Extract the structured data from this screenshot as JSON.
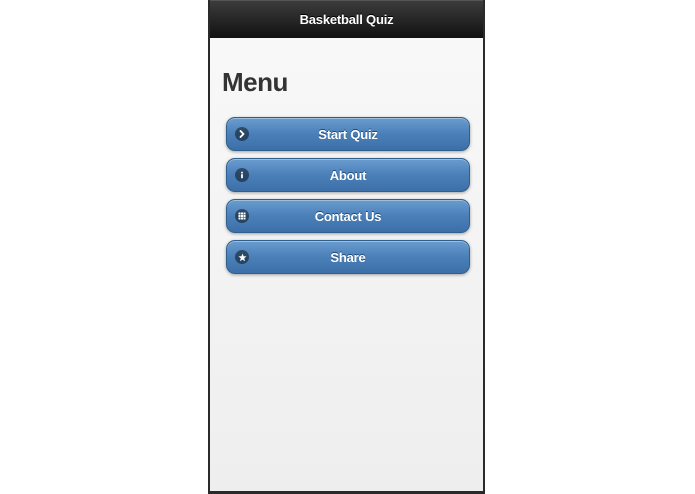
{
  "header": {
    "title": "Basketball Quiz"
  },
  "page": {
    "title": "Menu"
  },
  "menu": {
    "items": [
      {
        "label": "Start Quiz",
        "icon": "arrow-right-icon"
      },
      {
        "label": "About",
        "icon": "info-icon"
      },
      {
        "label": "Contact Us",
        "icon": "grid-icon"
      },
      {
        "label": "Share",
        "icon": "star-icon"
      }
    ]
  },
  "colors": {
    "header_bg": "#1a1a1a",
    "button_blue": "#4a7fb8",
    "page_bg": "#f3f3f3"
  }
}
